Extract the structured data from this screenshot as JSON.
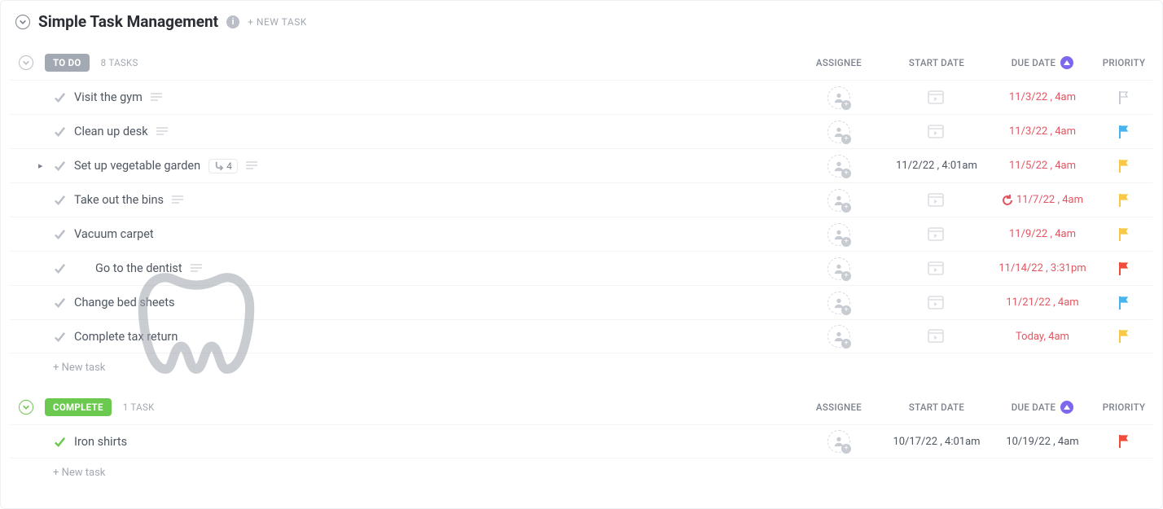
{
  "header": {
    "title": "Simple Task Management",
    "new_task_label": "+ NEW TASK"
  },
  "columns": {
    "assignee": "ASSIGNEE",
    "start": "START DATE",
    "due": "DUE DATE",
    "priority": "PRIORITY"
  },
  "groups": [
    {
      "id": "todo",
      "label": "TO DO",
      "count_label": "8 TASKS",
      "new_task_label": "+ New task",
      "tasks": [
        {
          "name": "Visit the gym",
          "has_desc": true,
          "start": "",
          "due": "11/3/22 , 4am",
          "due_overdue": true,
          "flag": "none"
        },
        {
          "name": "Clean up desk",
          "has_desc": true,
          "start": "",
          "due": "11/3/22 , 4am",
          "due_overdue": true,
          "flag": "blue"
        },
        {
          "name": "Set up vegetable garden",
          "expandable": true,
          "subtasks_label": "4",
          "has_desc": true,
          "start": "11/2/22 , 4:01am",
          "due": "11/5/22 , 4am",
          "due_overdue": true,
          "flag": "yellow"
        },
        {
          "name": "Take out the bins",
          "has_desc": true,
          "start": "",
          "due": "11/7/22 , 4am",
          "due_overdue": true,
          "recurring": true,
          "flag": "yellow"
        },
        {
          "name": "Vacuum carpet",
          "start": "",
          "due": "11/9/22 , 4am",
          "due_overdue": true,
          "flag": "yellow"
        },
        {
          "name": "Go to the dentist",
          "icon": "tooth",
          "has_desc": true,
          "start": "",
          "due": "11/14/22 , 3:31pm",
          "due_overdue": true,
          "flag": "red"
        },
        {
          "name": "Change bed sheets",
          "start": "",
          "due": "11/21/22 , 4am",
          "due_overdue": true,
          "flag": "blue"
        },
        {
          "name": "Complete tax return",
          "start": "",
          "due": "Today, 4am",
          "due_overdue": true,
          "flag": "yellow"
        }
      ]
    },
    {
      "id": "complete",
      "label": "COMPLETE",
      "count_label": "1 TASK",
      "new_task_label": "+ New task",
      "tasks": [
        {
          "name": "Iron shirts",
          "done": true,
          "start": "10/17/22 , 4:01am",
          "due": "10/19/22 , 4am",
          "due_overdue": false,
          "flag": "red"
        }
      ]
    }
  ],
  "flag_colors": {
    "none": "#c7ccd2",
    "blue": "#49b4eb",
    "yellow": "#f7c948",
    "red": "#ef4d3c"
  }
}
